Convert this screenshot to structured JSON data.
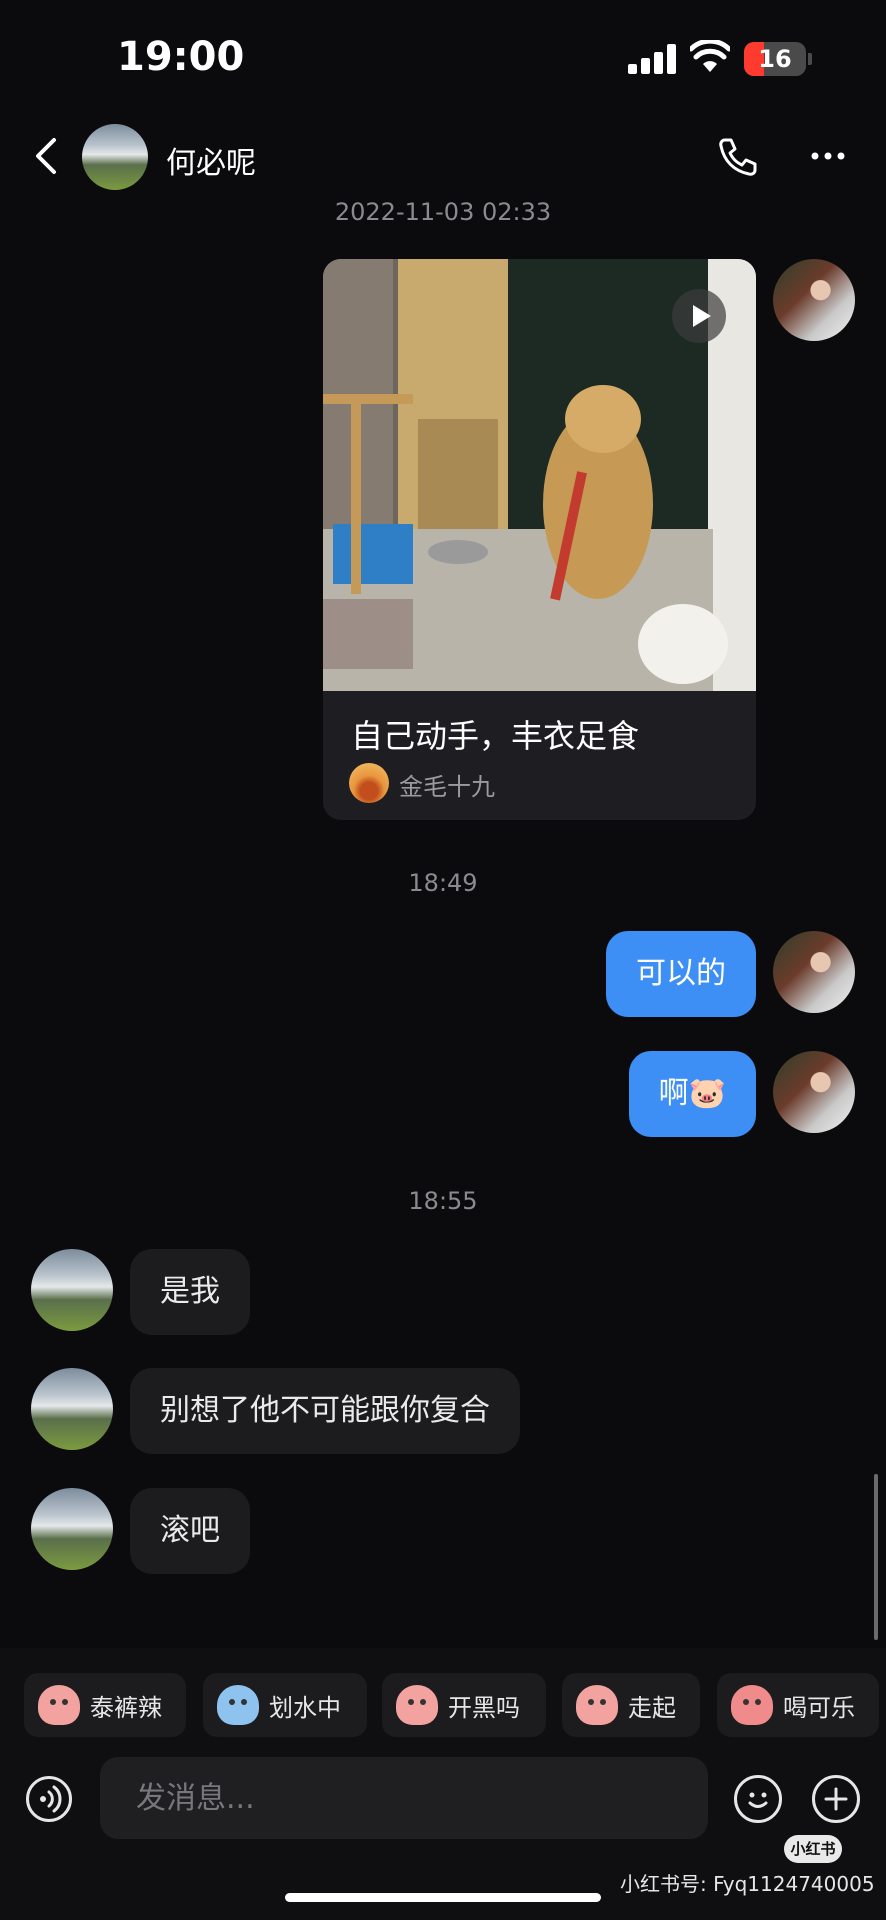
{
  "status_bar": {
    "time": "19:00",
    "battery": "16"
  },
  "header": {
    "contact_name": "何必呢"
  },
  "messages": {
    "timestamp_1": "2022-11-03 02:33",
    "shared_note": {
      "title": "自己动手，丰衣足食",
      "author": "金毛十九"
    },
    "timestamp_2": "18:49",
    "out_1": "可以的",
    "out_2": "啊🐷",
    "timestamp_3": "18:55",
    "in_1": "是我",
    "in_2": "别想了他不可能跟你复合",
    "in_3": "滚吧"
  },
  "quick_replies": [
    "泰裤辣",
    "划水中",
    "开黑吗",
    "走起",
    "喝可乐"
  ],
  "input": {
    "placeholder": "发消息..."
  },
  "watermark": {
    "logo": "小红书",
    "text": "小红书号: Fyq1124740005"
  },
  "colors": {
    "outgoing_bubble": "#3d8ff5",
    "incoming_bubble": "#1c1c1f",
    "background": "#0b0b0d"
  },
  "icons": [
    "back-icon",
    "phone-icon",
    "more-icon",
    "play-icon",
    "voice-icon",
    "emoji-icon",
    "plus-icon"
  ]
}
